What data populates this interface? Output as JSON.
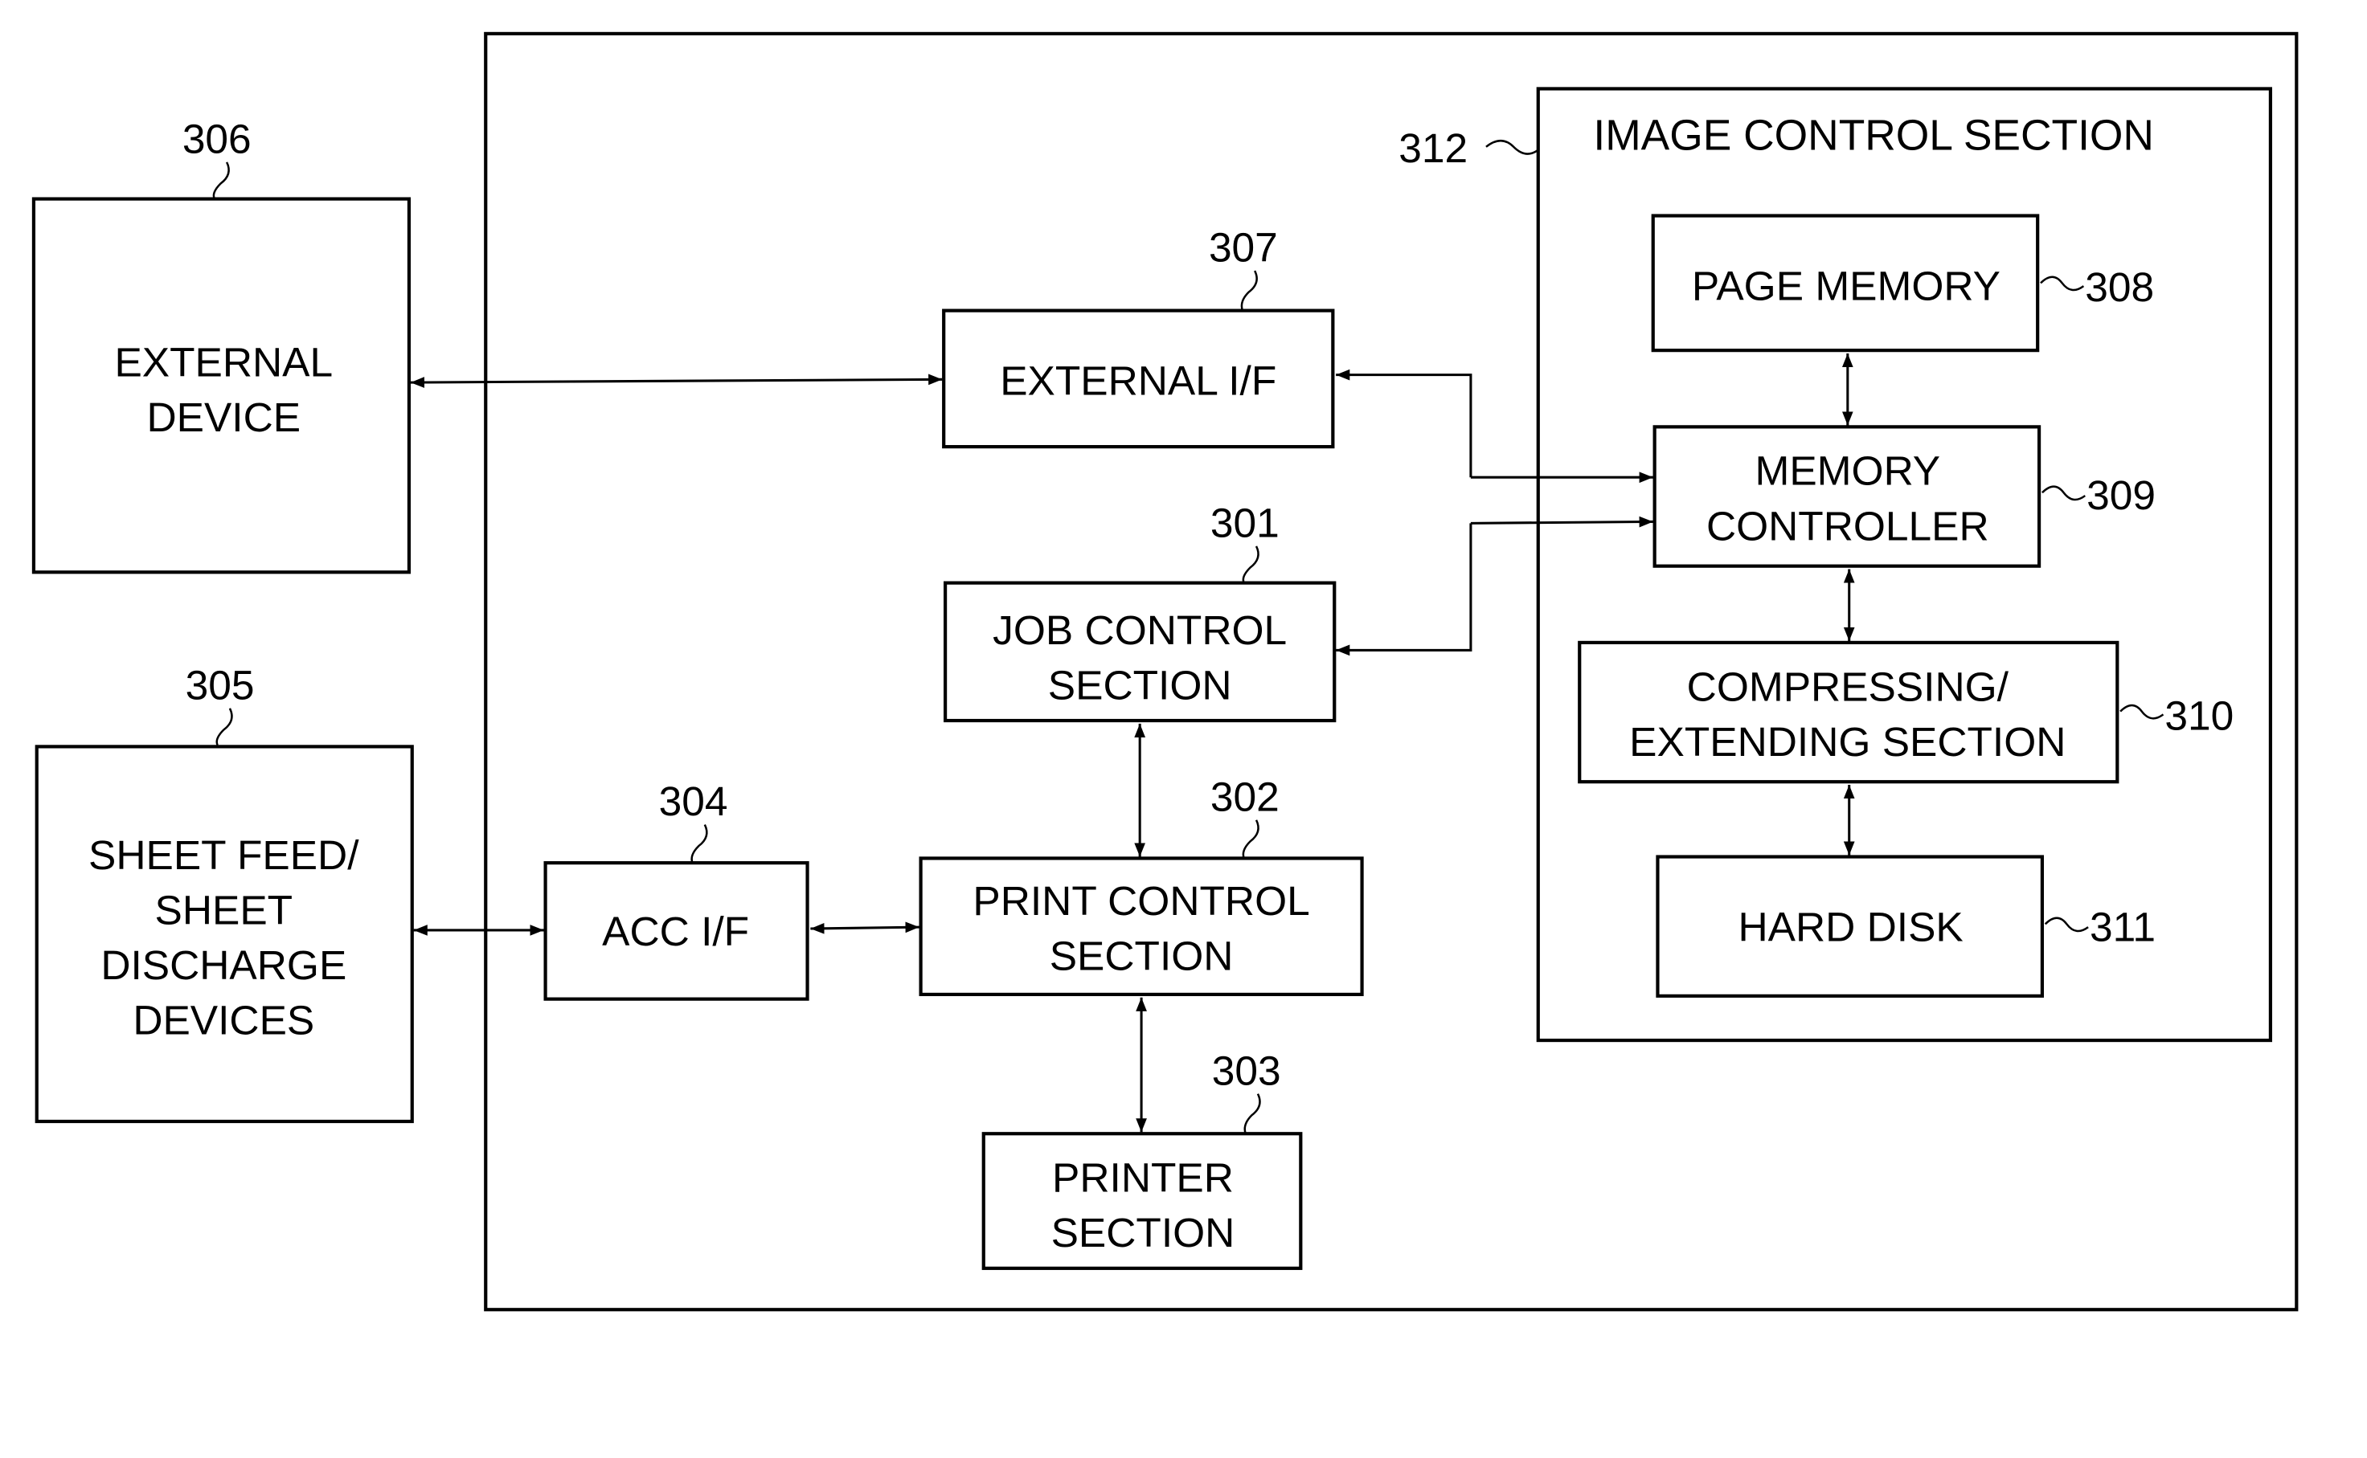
{
  "diagram": {
    "outer_frame": {
      "ref": ""
    },
    "image_control_section": {
      "title": "IMAGE CONTROL SECTION",
      "ref": "312"
    },
    "blocks": {
      "external_device": {
        "lines": [
          "EXTERNAL",
          "DEVICE"
        ],
        "ref": "306"
      },
      "sheet_devices": {
        "lines": [
          "SHEET FEED/",
          "SHEET",
          "DISCHARGE",
          "DEVICES"
        ],
        "ref": "305"
      },
      "external_if": {
        "lines": [
          "EXTERNAL I/F"
        ],
        "ref": "307"
      },
      "job_control": {
        "lines": [
          "JOB CONTROL",
          "SECTION"
        ],
        "ref": "301"
      },
      "acc_if": {
        "lines": [
          "ACC I/F"
        ],
        "ref": "304"
      },
      "print_control": {
        "lines": [
          "PRINT CONTROL",
          "SECTION"
        ],
        "ref": "302"
      },
      "printer_section": {
        "lines": [
          "PRINTER",
          "SECTION"
        ],
        "ref": "303"
      },
      "page_memory": {
        "lines": [
          "PAGE MEMORY"
        ],
        "ref": "308"
      },
      "memory_controller": {
        "lines": [
          "MEMORY",
          "CONTROLLER"
        ],
        "ref": "309"
      },
      "compressing": {
        "lines": [
          "COMPRESSING/",
          "EXTENDING SECTION"
        ],
        "ref": "310"
      },
      "hard_disk": {
        "lines": [
          "HARD DISK"
        ],
        "ref": "311"
      }
    },
    "connections": [
      {
        "from": "external_device",
        "to": "external_if",
        "direction": "bidirectional"
      },
      {
        "from": "memory_controller",
        "to": "external_if",
        "direction": "to-external_if"
      },
      {
        "from": "external_if",
        "to": "memory_controller",
        "direction": "to-memory_controller"
      },
      {
        "from": "memory_controller",
        "to": "job_control",
        "direction": "to-job_control"
      },
      {
        "from": "job_control",
        "to": "memory_controller",
        "direction": "to-memory_controller"
      },
      {
        "from": "page_memory",
        "to": "memory_controller",
        "direction": "bidirectional"
      },
      {
        "from": "memory_controller",
        "to": "compressing",
        "direction": "bidirectional"
      },
      {
        "from": "compressing",
        "to": "hard_disk",
        "direction": "bidirectional"
      },
      {
        "from": "job_control",
        "to": "print_control",
        "direction": "bidirectional"
      },
      {
        "from": "print_control",
        "to": "printer_section",
        "direction": "bidirectional"
      },
      {
        "from": "acc_if",
        "to": "print_control",
        "direction": "bidirectional"
      },
      {
        "from": "sheet_devices",
        "to": "acc_if",
        "direction": "bidirectional"
      }
    ]
  }
}
